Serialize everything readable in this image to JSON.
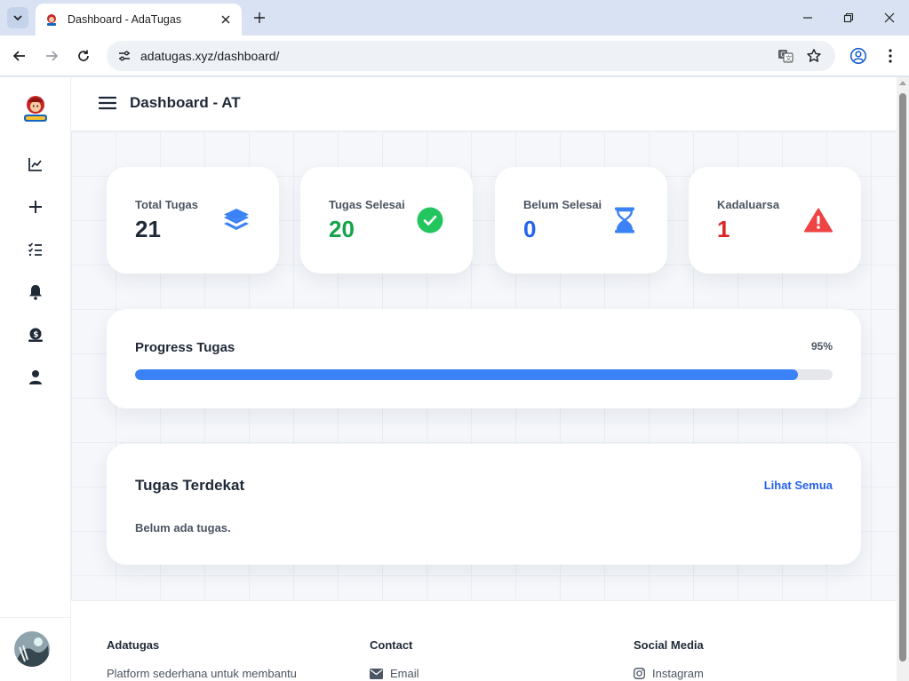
{
  "browser": {
    "tab_title": "Dashboard - AdaTugas",
    "url": "adatugas.xyz/dashboard/",
    "icons": [
      "tab-search-icon",
      "close-icon",
      "plus-icon",
      "minimize-icon",
      "restore-icon",
      "close-window-icon",
      "back-icon",
      "forward-icon",
      "reload-icon",
      "site-settings-icon",
      "translate-icon",
      "star-icon",
      "profile-icon",
      "kebab-menu-icon"
    ]
  },
  "sidebar": {
    "items": [
      {
        "icon": "chart-line-icon"
      },
      {
        "icon": "plus-icon"
      },
      {
        "icon": "task-list-icon"
      },
      {
        "icon": "bell-icon"
      },
      {
        "icon": "money-icon"
      },
      {
        "icon": "user-icon"
      }
    ]
  },
  "header": {
    "title": "Dashboard - AT"
  },
  "stats": [
    {
      "label": "Total Tugas",
      "value": "21",
      "color": "#1f2937",
      "icon": "layers-icon",
      "icon_color": "#3b82f6"
    },
    {
      "label": "Tugas Selesai",
      "value": "20",
      "color": "#16a34a",
      "icon": "check-circle-icon",
      "icon_color": "#22c55e"
    },
    {
      "label": "Belum Selesai",
      "value": "0",
      "color": "#2563eb",
      "icon": "hourglass-icon",
      "icon_color": "#3b82f6"
    },
    {
      "label": "Kadaluarsa",
      "value": "1",
      "color": "#dc2626",
      "icon": "warning-icon",
      "icon_color": "#ef4444"
    }
  ],
  "progress": {
    "title": "Progress Tugas",
    "percent_label": "95%",
    "percent": 0.95,
    "color": "#3b82f6"
  },
  "nearest": {
    "title": "Tugas Terdekat",
    "see_all": "Lihat Semua",
    "empty": "Belum ada tugas."
  },
  "footer": {
    "col1": {
      "heading": "Adatugas",
      "text": "Platform sederhana untuk membantu"
    },
    "col2": {
      "heading": "Contact",
      "item": "Email",
      "icon": "envelope-icon"
    },
    "col3": {
      "heading": "Social Media",
      "item": "Instagram",
      "icon": "instagram-icon"
    }
  }
}
